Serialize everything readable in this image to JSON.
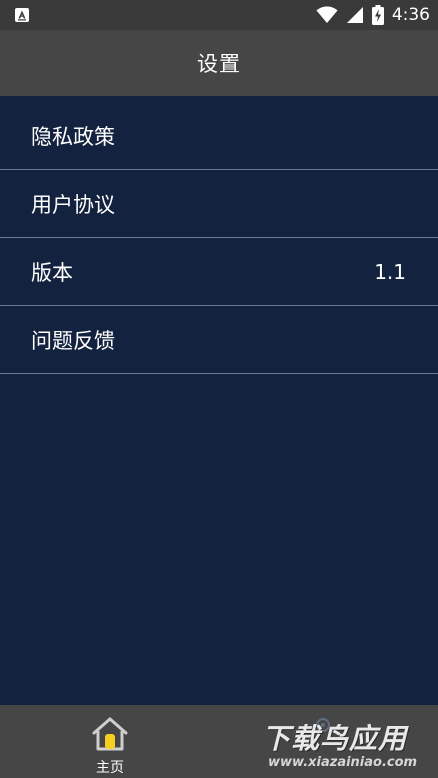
{
  "status_bar": {
    "time": "4:36",
    "icons": [
      "app-notification-icon",
      "wifi-icon",
      "signal-icon",
      "battery-charging-icon"
    ]
  },
  "header": {
    "title": "设置"
  },
  "settings": {
    "items": [
      {
        "label": "隐私政策",
        "value": ""
      },
      {
        "label": "用户协议",
        "value": ""
      },
      {
        "label": "版本",
        "value": "1.1"
      },
      {
        "label": "问题反馈",
        "value": ""
      }
    ]
  },
  "bottom_nav": {
    "home_label": "主页"
  },
  "watermark": {
    "text": "下载鸟应用",
    "url": "www.xiazainiao.com"
  },
  "colors": {
    "background": "#13223f",
    "bar": "#464646",
    "divider": "#6b7890",
    "accent": "#f5d020"
  }
}
